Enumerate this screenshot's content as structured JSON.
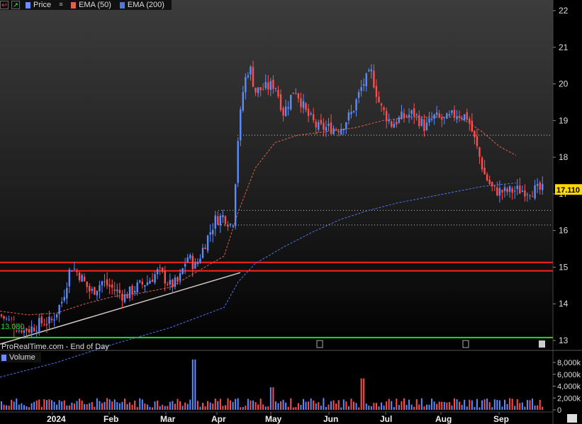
{
  "legend": {
    "price": "Price",
    "ema50": "EMA (50)",
    "ema200": "EMA (200)",
    "volume": "Volume"
  },
  "watermark": "ProRealTime.com - End of Day",
  "colors": {
    "background": "#000000",
    "up": "#5b8cff",
    "down": "#ff4d4d",
    "ema50": "#e0604a",
    "ema200": "#4a78e8",
    "resistance": "#ff2020",
    "support_green": "#22dd22",
    "trendline": "#d8c8c8",
    "current_label_bg": "#ffd800"
  },
  "chart_data": {
    "type": "candlestick",
    "y_axis": {
      "ticks": [
        13,
        14,
        15,
        16,
        17,
        18,
        19,
        20,
        21,
        22
      ],
      "range": [
        12.85,
        22.25
      ]
    },
    "x_axis": {
      "labels": [
        "2024",
        "Feb",
        "Mar",
        "Apr",
        "May",
        "Jun",
        "Jul",
        "Aug",
        "Sep"
      ]
    },
    "current_price": "17.110",
    "low_marker": "13.080",
    "horizontal_levels": [
      {
        "value": 15.13,
        "style": "solid-red"
      },
      {
        "value": 14.9,
        "style": "solid-red"
      },
      {
        "value": 13.08,
        "style": "solid-green"
      },
      {
        "value": 18.6,
        "style": "dotted"
      },
      {
        "value": 16.55,
        "style": "dotted"
      },
      {
        "value": 16.15,
        "style": "dotted"
      }
    ],
    "trendline": {
      "from": {
        "month": "Dec 2023",
        "value": 12.9
      },
      "to": {
        "month": "Apr 2024",
        "value": 14.85
      }
    },
    "price_path": [
      [
        0.0,
        13.7
      ],
      [
        0.05,
        13.4
      ],
      [
        0.1,
        13.3
      ],
      [
        0.15,
        13.5
      ],
      [
        0.18,
        13.5
      ],
      [
        0.22,
        14.1
      ],
      [
        0.25,
        15.05
      ],
      [
        0.28,
        14.8
      ],
      [
        0.32,
        14.3
      ],
      [
        0.36,
        14.6
      ],
      [
        0.4,
        14.4
      ],
      [
        0.44,
        14.2
      ],
      [
        0.48,
        14.45
      ],
      [
        0.52,
        14.6
      ],
      [
        0.56,
        14.9
      ],
      [
        0.6,
        14.5
      ],
      [
        0.63,
        14.6
      ],
      [
        0.66,
        15.3
      ],
      [
        0.69,
        15.0
      ],
      [
        0.72,
        15.6
      ],
      [
        0.76,
        16.3
      ],
      [
        0.79,
        16.4
      ],
      [
        0.82,
        16.1
      ],
      [
        0.84,
        18.6
      ],
      [
        0.86,
        20.0
      ],
      [
        0.88,
        20.5
      ],
      [
        0.9,
        19.8
      ],
      [
        0.94,
        19.9
      ],
      [
        0.97,
        20.0
      ],
      [
        1.0,
        19.2
      ],
      [
        1.04,
        19.9
      ],
      [
        1.08,
        19.2
      ],
      [
        1.12,
        18.8
      ],
      [
        1.16,
        18.8
      ],
      [
        1.2,
        18.8
      ],
      [
        1.24,
        19.2
      ],
      [
        1.28,
        20.0
      ],
      [
        1.31,
        20.3
      ],
      [
        1.34,
        19.4
      ],
      [
        1.38,
        18.9
      ],
      [
        1.42,
        19.1
      ],
      [
        1.46,
        19.2
      ],
      [
        1.5,
        18.8
      ],
      [
        1.53,
        19.1
      ],
      [
        1.57,
        19.0
      ],
      [
        1.61,
        19.2
      ],
      [
        1.65,
        19.1
      ],
      [
        1.68,
        18.3
      ],
      [
        1.71,
        17.5
      ],
      [
        1.74,
        17.1
      ],
      [
        1.78,
        17.05
      ],
      [
        1.82,
        17.1
      ]
    ],
    "ema50_path": [
      [
        0.0,
        13.8
      ],
      [
        0.1,
        13.7
      ],
      [
        0.2,
        13.75
      ],
      [
        0.3,
        14.0
      ],
      [
        0.4,
        14.2
      ],
      [
        0.5,
        14.3
      ],
      [
        0.6,
        14.45
      ],
      [
        0.7,
        14.9
      ],
      [
        0.79,
        15.3
      ],
      [
        0.84,
        16.5
      ],
      [
        0.9,
        17.7
      ],
      [
        0.97,
        18.4
      ],
      [
        1.05,
        18.6
      ],
      [
        1.15,
        18.7
      ],
      [
        1.25,
        18.8
      ],
      [
        1.35,
        19.0
      ],
      [
        1.45,
        19.1
      ],
      [
        1.55,
        19.1
      ],
      [
        1.62,
        19.1
      ],
      [
        1.7,
        18.7
      ],
      [
        1.76,
        18.3
      ],
      [
        1.82,
        18.05
      ]
    ],
    "ema200_path": [
      [
        0.0,
        12.0
      ],
      [
        0.2,
        12.4
      ],
      [
        0.4,
        12.9
      ],
      [
        0.6,
        13.35
      ],
      [
        0.79,
        13.9
      ],
      [
        0.84,
        14.6
      ],
      [
        0.9,
        15.1
      ],
      [
        1.0,
        15.55
      ],
      [
        1.1,
        15.95
      ],
      [
        1.2,
        16.3
      ],
      [
        1.3,
        16.55
      ],
      [
        1.4,
        16.75
      ],
      [
        1.5,
        16.9
      ],
      [
        1.6,
        17.05
      ],
      [
        1.7,
        17.2
      ],
      [
        1.76,
        17.25
      ],
      [
        1.82,
        17.3
      ]
    ],
    "volume": {
      "ticks": [
        "8,000k",
        "6,000k",
        "4,000k",
        "2,000k",
        "0"
      ],
      "tick_values": [
        8000,
        6000,
        4000,
        2000,
        0
      ],
      "max": 9000,
      "spikes_k": [
        {
          "pos": 0.685,
          "value": 8500
        },
        {
          "pos": 1.28,
          "value": 5300
        },
        {
          "pos": 0.96,
          "value": 3800
        }
      ]
    }
  }
}
